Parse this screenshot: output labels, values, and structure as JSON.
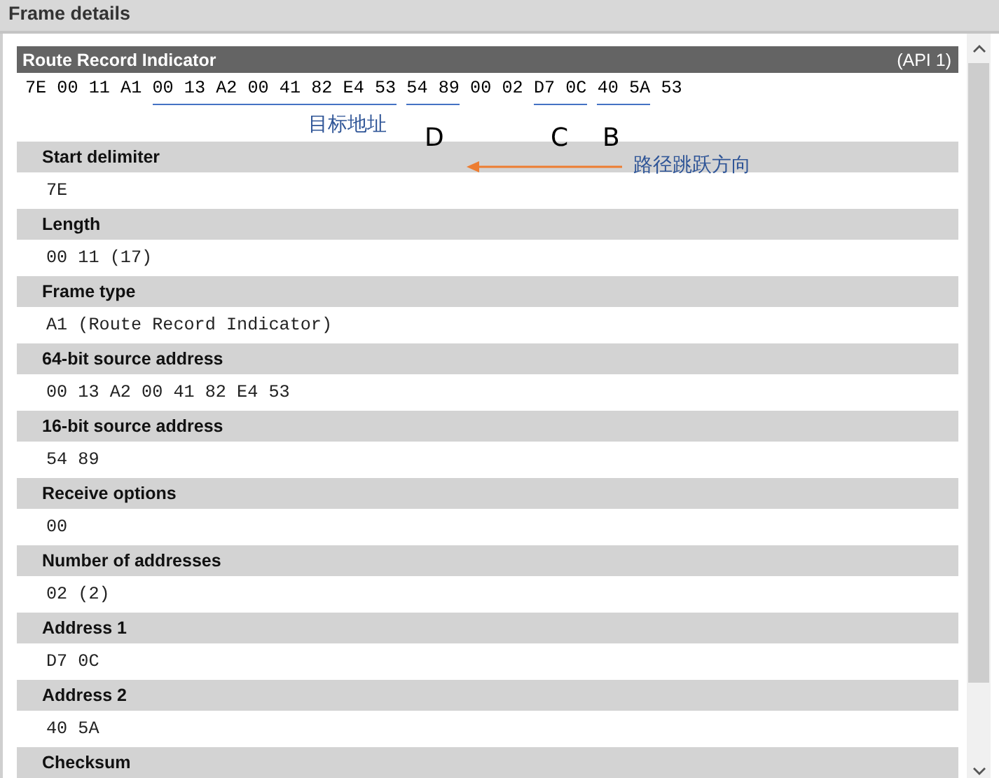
{
  "panel": {
    "title": "Frame details"
  },
  "frame": {
    "name": "Route Record Indicator",
    "api": "(API 1)"
  },
  "raw_bytes": [
    {
      "text": "7E 00 11 A1",
      "underlined": false
    },
    {
      "text": "00 13 A2 00 41 82 E4 53",
      "underlined": true
    },
    {
      "text": "54 89",
      "underlined": true
    },
    {
      "text": "00 02",
      "underlined": false
    },
    {
      "text": "D7 0C",
      "underlined": true
    },
    {
      "text": "40 5A",
      "underlined": true
    },
    {
      "text": "53",
      "underlined": false
    }
  ],
  "annotations": {
    "destination_label": "目标地址",
    "hops": [
      "D",
      "C",
      "B"
    ],
    "direction_label": "路径跳跃方向"
  },
  "fields": [
    {
      "name": "Start delimiter",
      "value": "7E"
    },
    {
      "name": "Length",
      "value": "00 11 (17)"
    },
    {
      "name": "Frame type",
      "value": "A1 (Route Record Indicator)"
    },
    {
      "name": "64-bit source address",
      "value": "00 13 A2 00 41 82 E4 53"
    },
    {
      "name": "16-bit source address",
      "value": "54 89"
    },
    {
      "name": "Receive options",
      "value": "00"
    },
    {
      "name": "Number of addresses",
      "value": "02 (2)"
    },
    {
      "name": "Address 1",
      "value": "D7 0C"
    },
    {
      "name": "Address 2",
      "value": "40 5A"
    },
    {
      "name": "Checksum"
    }
  ]
}
